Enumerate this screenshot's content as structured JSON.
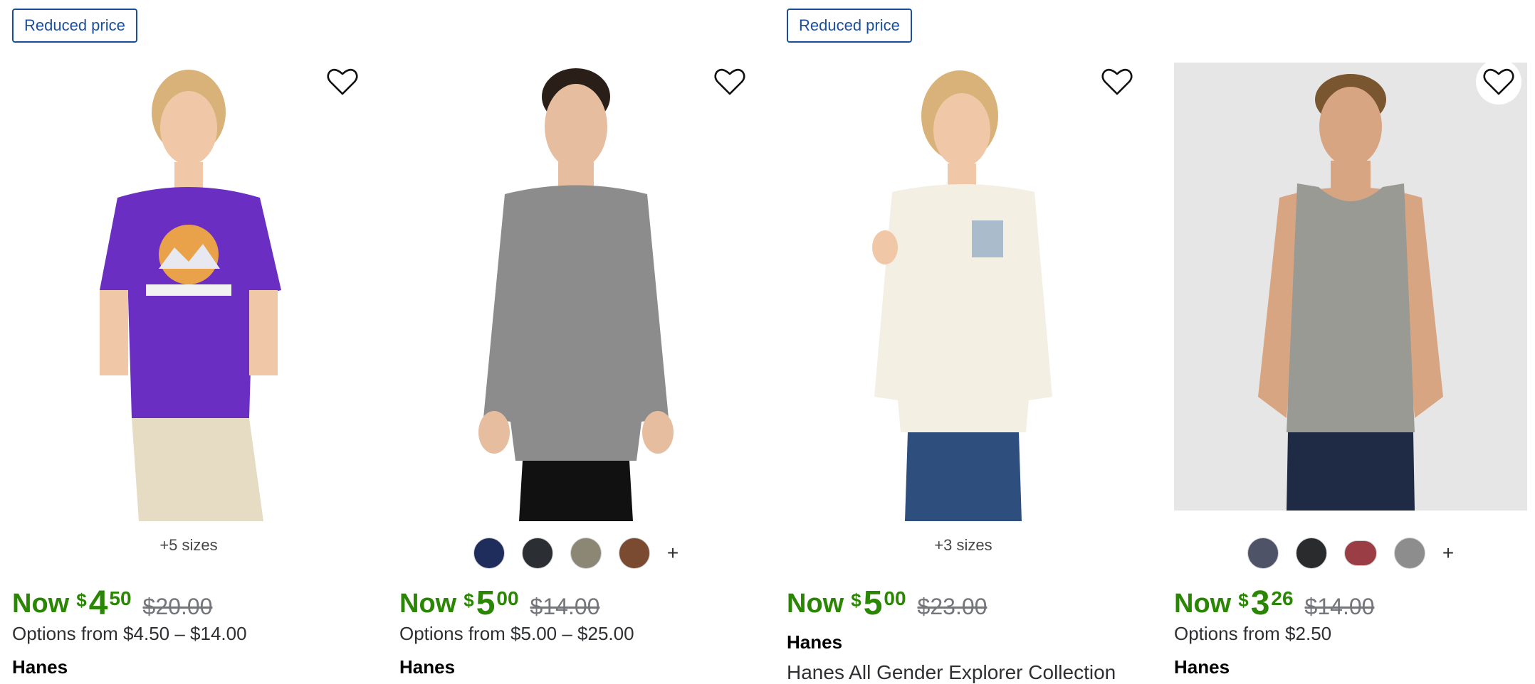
{
  "products": [
    {
      "badge": "Reduced price",
      "sizes_note": "+5 sizes",
      "price": {
        "now_label": "Now",
        "currency": "$",
        "dollars": "4",
        "cents": "50",
        "was": "$20.00"
      },
      "options": "Options from $4.50 – $14.00",
      "brand": "Hanes",
      "image_icon": "purple-tshirt-photo"
    },
    {
      "swatches": [
        {
          "color": "#1e2d5c"
        },
        {
          "color": "#2b2f33"
        },
        {
          "color": "#8c8775"
        },
        {
          "color": "#7a4a31"
        }
      ],
      "more_symbol": "+",
      "price": {
        "now_label": "Now",
        "currency": "$",
        "dollars": "5",
        "cents": "00",
        "was": "$14.00"
      },
      "options": "Options from $5.00 – $25.00",
      "brand": "Hanes",
      "image_icon": "gray-longsleeve-photo"
    },
    {
      "badge": "Reduced price",
      "sizes_note": "+3 sizes",
      "price": {
        "now_label": "Now",
        "currency": "$",
        "dollars": "5",
        "cents": "00",
        "was": "$23.00"
      },
      "brand": "Hanes",
      "title": "Hanes All Gender Explorer Collection",
      "image_icon": "cream-longsleeve-photo"
    },
    {
      "swatches": [
        {
          "color": "#4e5368"
        },
        {
          "color": "#2a2b2d"
        },
        {
          "color": "#9a3d45"
        },
        {
          "color": "#8d8d8d"
        }
      ],
      "more_symbol": "+",
      "price": {
        "now_label": "Now",
        "currency": "$",
        "dollars": "3",
        "cents": "26",
        "was": "$14.00"
      },
      "options": "Options from $2.50",
      "brand": "Hanes",
      "image_icon": "gray-tanktop-photo"
    }
  ],
  "colors": {
    "price_green": "#2a8703",
    "badge_blue": "#1c4f9a",
    "heart_icon": "heart-outline-icon"
  }
}
